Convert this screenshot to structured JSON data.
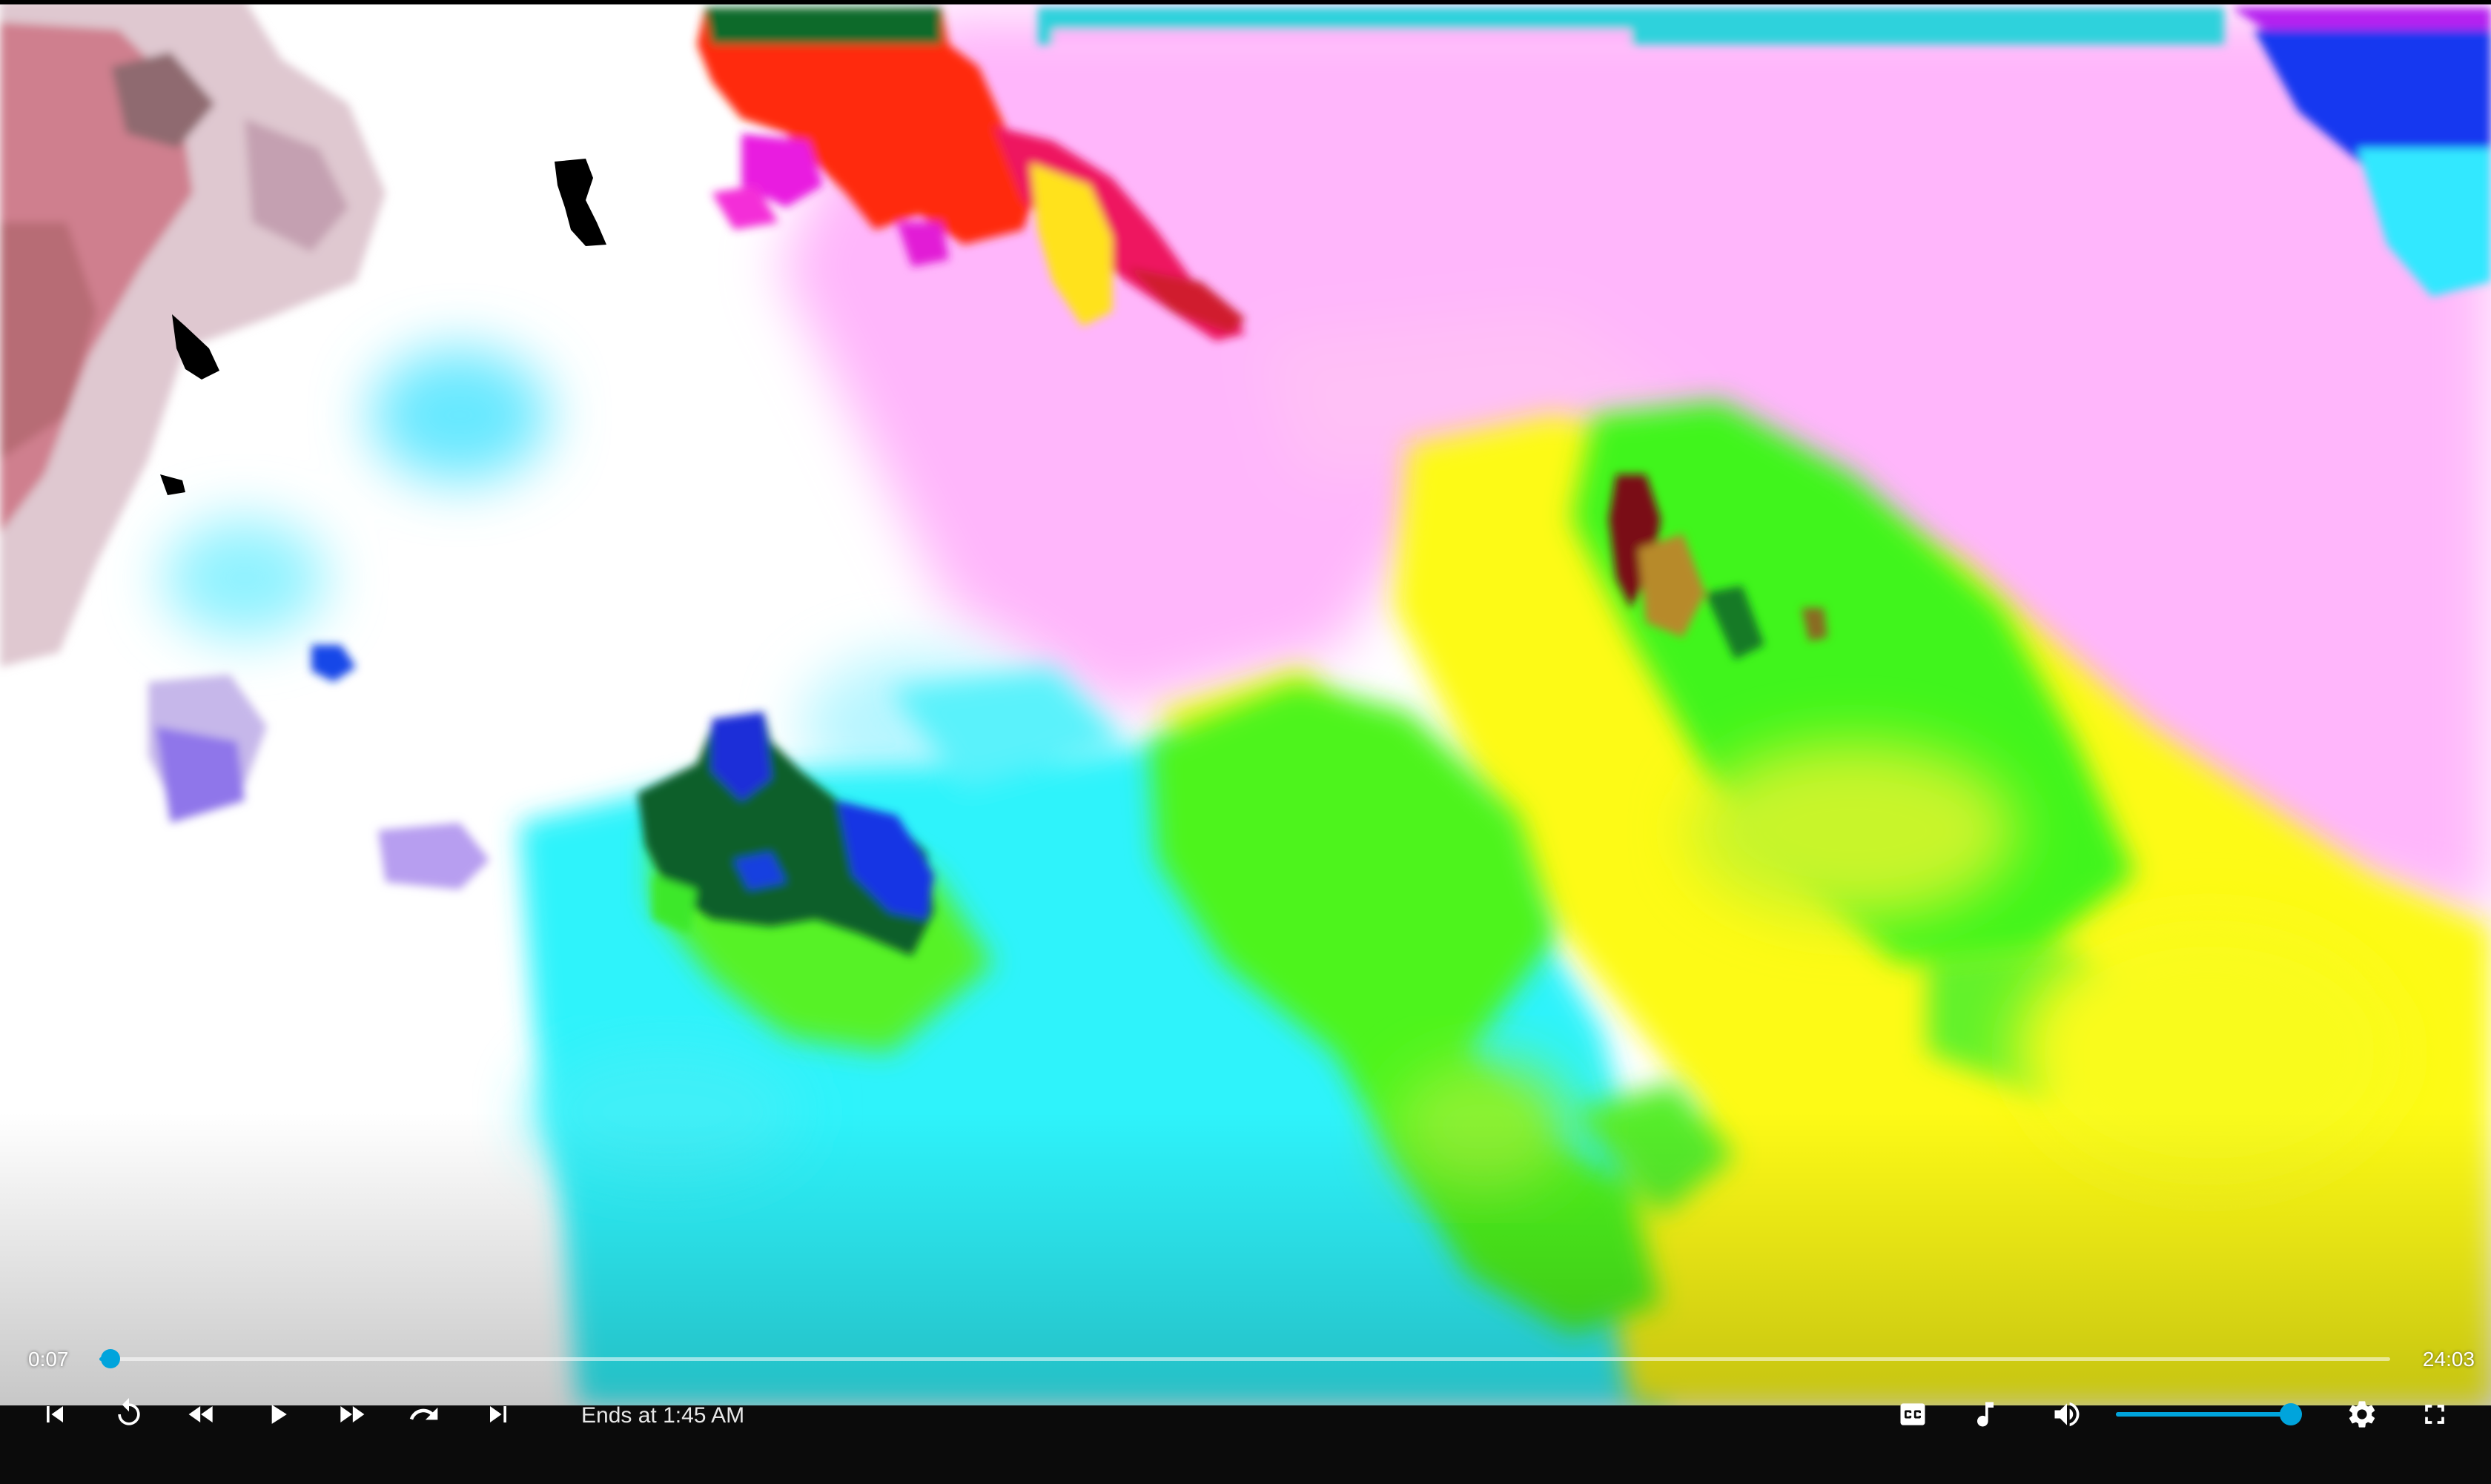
{
  "player": {
    "current_time": "0:07",
    "total_time": "24:03",
    "ends_at": "Ends at 1:45 AM",
    "progress_fraction": 0.005,
    "volume_fraction": 1.0,
    "accent_color": "#00a4dc"
  },
  "controls": {
    "left": [
      "previous-track-icon",
      "replay-icon",
      "rewind-icon",
      "play-icon",
      "fast-forward-icon",
      "forward-icon",
      "next-track-icon"
    ],
    "right": [
      "closed-captions-icon",
      "music-note-icon",
      "volume-icon",
      "settings-gear-icon",
      "fullscreen-icon"
    ]
  }
}
